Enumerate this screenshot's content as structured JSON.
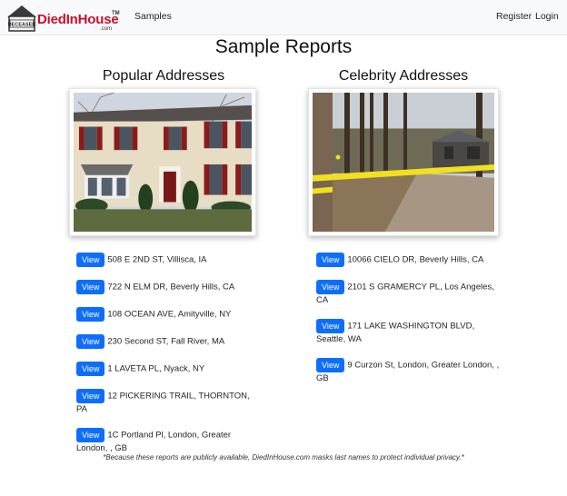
{
  "nav": {
    "brand_deceased": "DECEASED",
    "brand_name": "DiedInHouse",
    "brand_tm": "TM",
    "brand_com": ".com",
    "samples": "Samples",
    "register": "Register",
    "login": "Login"
  },
  "page_title": "Sample Reports",
  "popular": {
    "title": "Popular Addresses",
    "button_label": "View",
    "items": [
      "508 E 2ND ST, Villisca, IA",
      "722 N ELM DR, Beverly Hills, CA",
      "108 OCEAN AVE, Amityville, NY",
      "230 Second ST, Fall River, MA",
      "1 LAVETA PL, Nyack, NY",
      "12 PICKERING TRAIL, THORNTON, PA",
      "1C Portland Pl, London, Greater London, , GB"
    ]
  },
  "celebrity": {
    "title": "Celebrity Addresses",
    "button_label": "View",
    "items": [
      "10066 CIELO DR, Beverly Hills, CA",
      "2101 S GRAMERCY PL, Los Angeles, CA",
      "171 LAKE WASHINGTON BLVD, Seattle, WA",
      "9 Curzon St, London, Greater London, , GB"
    ]
  },
  "footnote": "*Because these reports are publicly available, DiedInHouse.com masks last names to protect individual privacy.*",
  "colors": {
    "brand_red": "#c8102e",
    "button_blue": "#0d6efd",
    "navbar_bg": "#f8f9fa"
  }
}
